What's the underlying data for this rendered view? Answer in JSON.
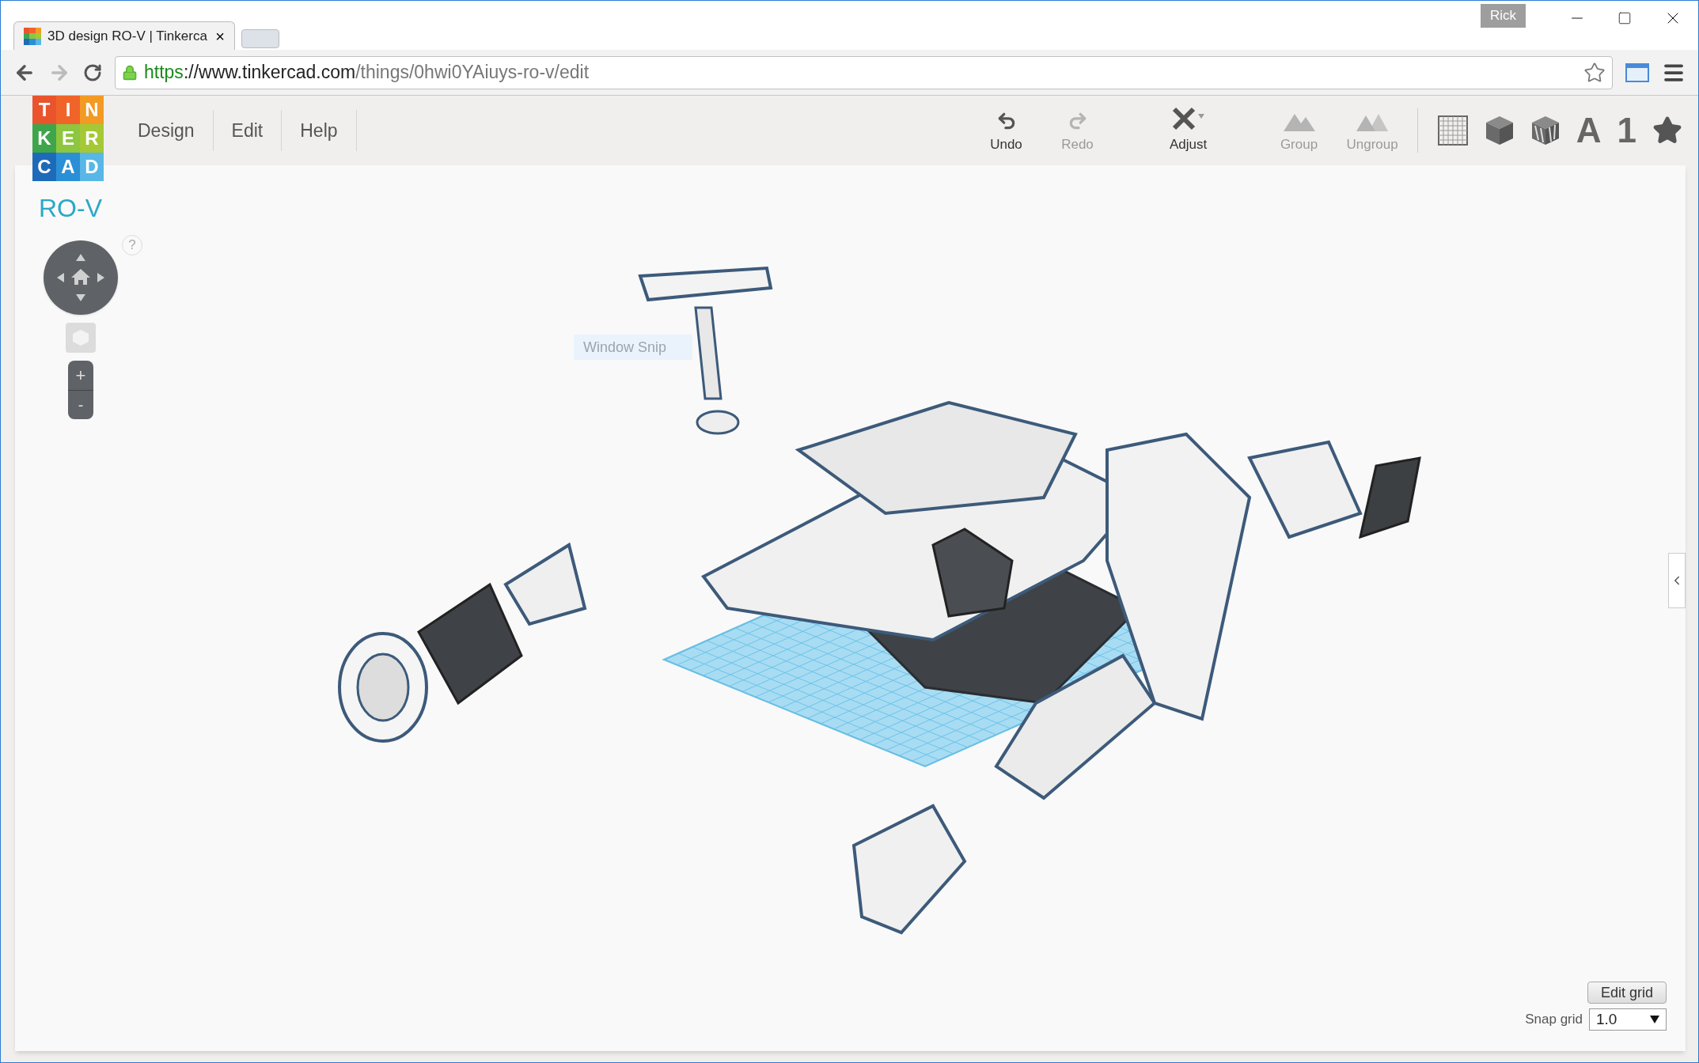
{
  "browser": {
    "tab": {
      "title": "3D design RO-V | Tinkerca",
      "close": "×"
    },
    "user": "Rick",
    "address": {
      "scheme": "https",
      "host": "://www.tinkercad.com",
      "path": "/things/0hwi0YAiuys-ro-v/edit"
    }
  },
  "logo": [
    {
      "letter": "T",
      "color": "#e9542d"
    },
    {
      "letter": "I",
      "color": "#f0642a"
    },
    {
      "letter": "N",
      "color": "#f39a25"
    },
    {
      "letter": "K",
      "color": "#3fa54a"
    },
    {
      "letter": "E",
      "color": "#8ec63f"
    },
    {
      "letter": "R",
      "color": "#a5c836"
    },
    {
      "letter": "C",
      "color": "#1d6bb8"
    },
    {
      "letter": "A",
      "color": "#2b8fd6"
    },
    {
      "letter": "D",
      "color": "#58b7e6"
    }
  ],
  "menu": [
    "Design",
    "Edit",
    "Help"
  ],
  "toolbar": [
    {
      "kind": "undo",
      "label": "Undo",
      "disabled": false
    },
    {
      "kind": "redo",
      "label": "Redo",
      "disabled": true
    },
    {
      "kind": "adjust",
      "label": "Adjust",
      "disabled": false
    },
    {
      "kind": "group",
      "label": "Group",
      "disabled": true
    },
    {
      "kind": "ungroup",
      "label": "Ungroup",
      "disabled": true
    }
  ],
  "view_tools": [
    {
      "kind": "grid"
    },
    {
      "kind": "box"
    },
    {
      "kind": "striped-box"
    },
    {
      "kind": "text",
      "text": "A"
    },
    {
      "kind": "text",
      "text": "1"
    },
    {
      "kind": "star"
    }
  ],
  "design_title": "RO-V",
  "nav": {
    "help": "?",
    "zoom_in": "+",
    "zoom_out": "-"
  },
  "overlay": "Window Snip",
  "grid": {
    "edit_button": "Edit grid",
    "snap_label": "Snap grid",
    "snap_value": "1.0"
  }
}
